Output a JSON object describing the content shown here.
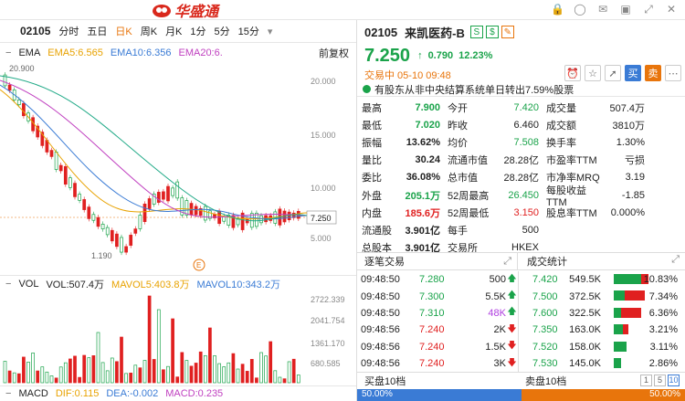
{
  "app": {
    "title": "华盛通"
  },
  "toolbar": {
    "code": "02105",
    "periods": [
      "分时",
      "五日",
      "日K",
      "周K",
      "月K",
      "1分",
      "5分",
      "15分"
    ],
    "active": "日K"
  },
  "ema": {
    "label": "EMA",
    "ema5": "EMA5:6.565",
    "ema10": "EMA10:6.356",
    "ema20": "EMA20:6.",
    "adjust": "前复权"
  },
  "kline": {
    "high_label": "20.900",
    "low_label": "1.190",
    "axis": [
      "20.000",
      "15.000",
      "10.000",
      "5.000"
    ],
    "current": "7.250",
    "marker": "E"
  },
  "vol": {
    "label": "VOL",
    "vol": "VOL:507.4万",
    "mavol5": "MAVOL5:403.8万",
    "mavol10": "MAVOL10:343.2万",
    "axis": [
      "2722.339",
      "2041.754",
      "1361.170",
      "680.585"
    ]
  },
  "macd": {
    "label": "MACD",
    "dif": "DIF:0.115",
    "dea": "DEA:-0.002",
    "macd": "MACD:0.235"
  },
  "quote": {
    "code": "02105",
    "name": "来凯医药-B",
    "tags": [
      "S",
      "$",
      "✎"
    ],
    "price": "7.250",
    "change": "0.790",
    "pct": "12.23%",
    "status": "交易中 05-10 09:48",
    "notice": "有股东从非中央结算系统单日转出7.59%股票"
  },
  "buttons": {
    "buy": "买",
    "sell": "卖"
  },
  "stats": [
    [
      {
        "l": "最高",
        "v": "7.900",
        "c": "green"
      },
      {
        "l": "今开",
        "v": "7.420",
        "c": "green"
      },
      {
        "l": "成交量",
        "v": "507.4万",
        "c": "dark"
      }
    ],
    [
      {
        "l": "最低",
        "v": "7.020",
        "c": "green"
      },
      {
        "l": "昨收",
        "v": "6.460",
        "c": "dark"
      },
      {
        "l": "成交额",
        "v": "3810万",
        "c": "dark"
      }
    ],
    [
      {
        "l": "振幅",
        "v": "13.62%",
        "c": "dark"
      },
      {
        "l": "均价",
        "v": "7.508",
        "c": "green"
      },
      {
        "l": "换手率",
        "v": "1.30%",
        "c": "dark"
      }
    ],
    [
      {
        "l": "量比",
        "v": "30.24",
        "c": "dark"
      },
      {
        "l": "流通市值",
        "v": "28.28亿",
        "c": "dark"
      },
      {
        "l": "市盈率TTM",
        "v": "亏损",
        "c": "dark"
      }
    ],
    [
      {
        "l": "委比",
        "v": "36.08%",
        "c": "dark"
      },
      {
        "l": "总市值",
        "v": "28.28亿",
        "c": "dark"
      },
      {
        "l": "市净率MRQ",
        "v": "3.19",
        "c": "dark"
      }
    ],
    [
      {
        "l": "外盘",
        "v": "205.1万",
        "c": "green"
      },
      {
        "l": "52周最高",
        "v": "26.450",
        "c": "green"
      },
      {
        "l": "每股收益TTM",
        "v": "-1.85",
        "c": "dark"
      }
    ],
    [
      {
        "l": "内盘",
        "v": "185.6万",
        "c": "red"
      },
      {
        "l": "52周最低",
        "v": "3.150",
        "c": "red"
      },
      {
        "l": "股息率TTM",
        "v": "0.000%",
        "c": "dark"
      }
    ],
    [
      {
        "l": "流通股",
        "v": "3.901亿",
        "c": "dark"
      },
      {
        "l": "每手",
        "v": "500",
        "c": "dark"
      },
      {
        "l": "",
        "v": "",
        "c": "dark"
      }
    ],
    [
      {
        "l": "总股本",
        "v": "3.901亿",
        "c": "dark"
      },
      {
        "l": "交易所",
        "v": "HKEX",
        "c": "dark"
      },
      {
        "l": "",
        "v": "",
        "c": "dark"
      }
    ]
  ],
  "tabs": {
    "trades": "逐笔交易",
    "fills": "成交统计"
  },
  "trades": [
    {
      "t": "09:48:50",
      "p": "7.280",
      "q": "500",
      "d": "up",
      "qc": "dark"
    },
    {
      "t": "09:48:50",
      "p": "7.300",
      "q": "5.5K",
      "d": "up",
      "qc": "dark"
    },
    {
      "t": "09:48:50",
      "p": "7.310",
      "q": "48K",
      "d": "up",
      "qc": "purple"
    },
    {
      "t": "09:48:56",
      "p": "7.240",
      "q": "2K",
      "d": "down",
      "qc": "dark"
    },
    {
      "t": "09:48:56",
      "p": "7.240",
      "q": "1.5K",
      "d": "down",
      "qc": "dark"
    },
    {
      "t": "09:48:56",
      "p": "7.240",
      "q": "3K",
      "d": "down",
      "qc": "dark"
    }
  ],
  "fills": [
    {
      "p": "7.420",
      "v": "549.5K",
      "pct": "10.83%",
      "g": 30,
      "r": 8
    },
    {
      "p": "7.500",
      "v": "372.5K",
      "pct": "7.34%",
      "g": 12,
      "r": 22
    },
    {
      "p": "7.600",
      "v": "322.5K",
      "pct": "6.36%",
      "g": 8,
      "r": 22
    },
    {
      "p": "7.350",
      "v": "163.0K",
      "pct": "3.21%",
      "g": 10,
      "r": 6
    },
    {
      "p": "7.520",
      "v": "158.0K",
      "pct": "3.11%",
      "g": 14,
      "r": 0
    },
    {
      "p": "7.530",
      "v": "145.0K",
      "pct": "2.86%",
      "g": 8,
      "r": 0
    }
  ],
  "bottom": {
    "buy10": "买盘10档",
    "sell10": "卖盘10档",
    "pages": [
      "1",
      "5",
      "10"
    ],
    "left_pct": "50.00%",
    "right_pct": "50.00%"
  }
}
